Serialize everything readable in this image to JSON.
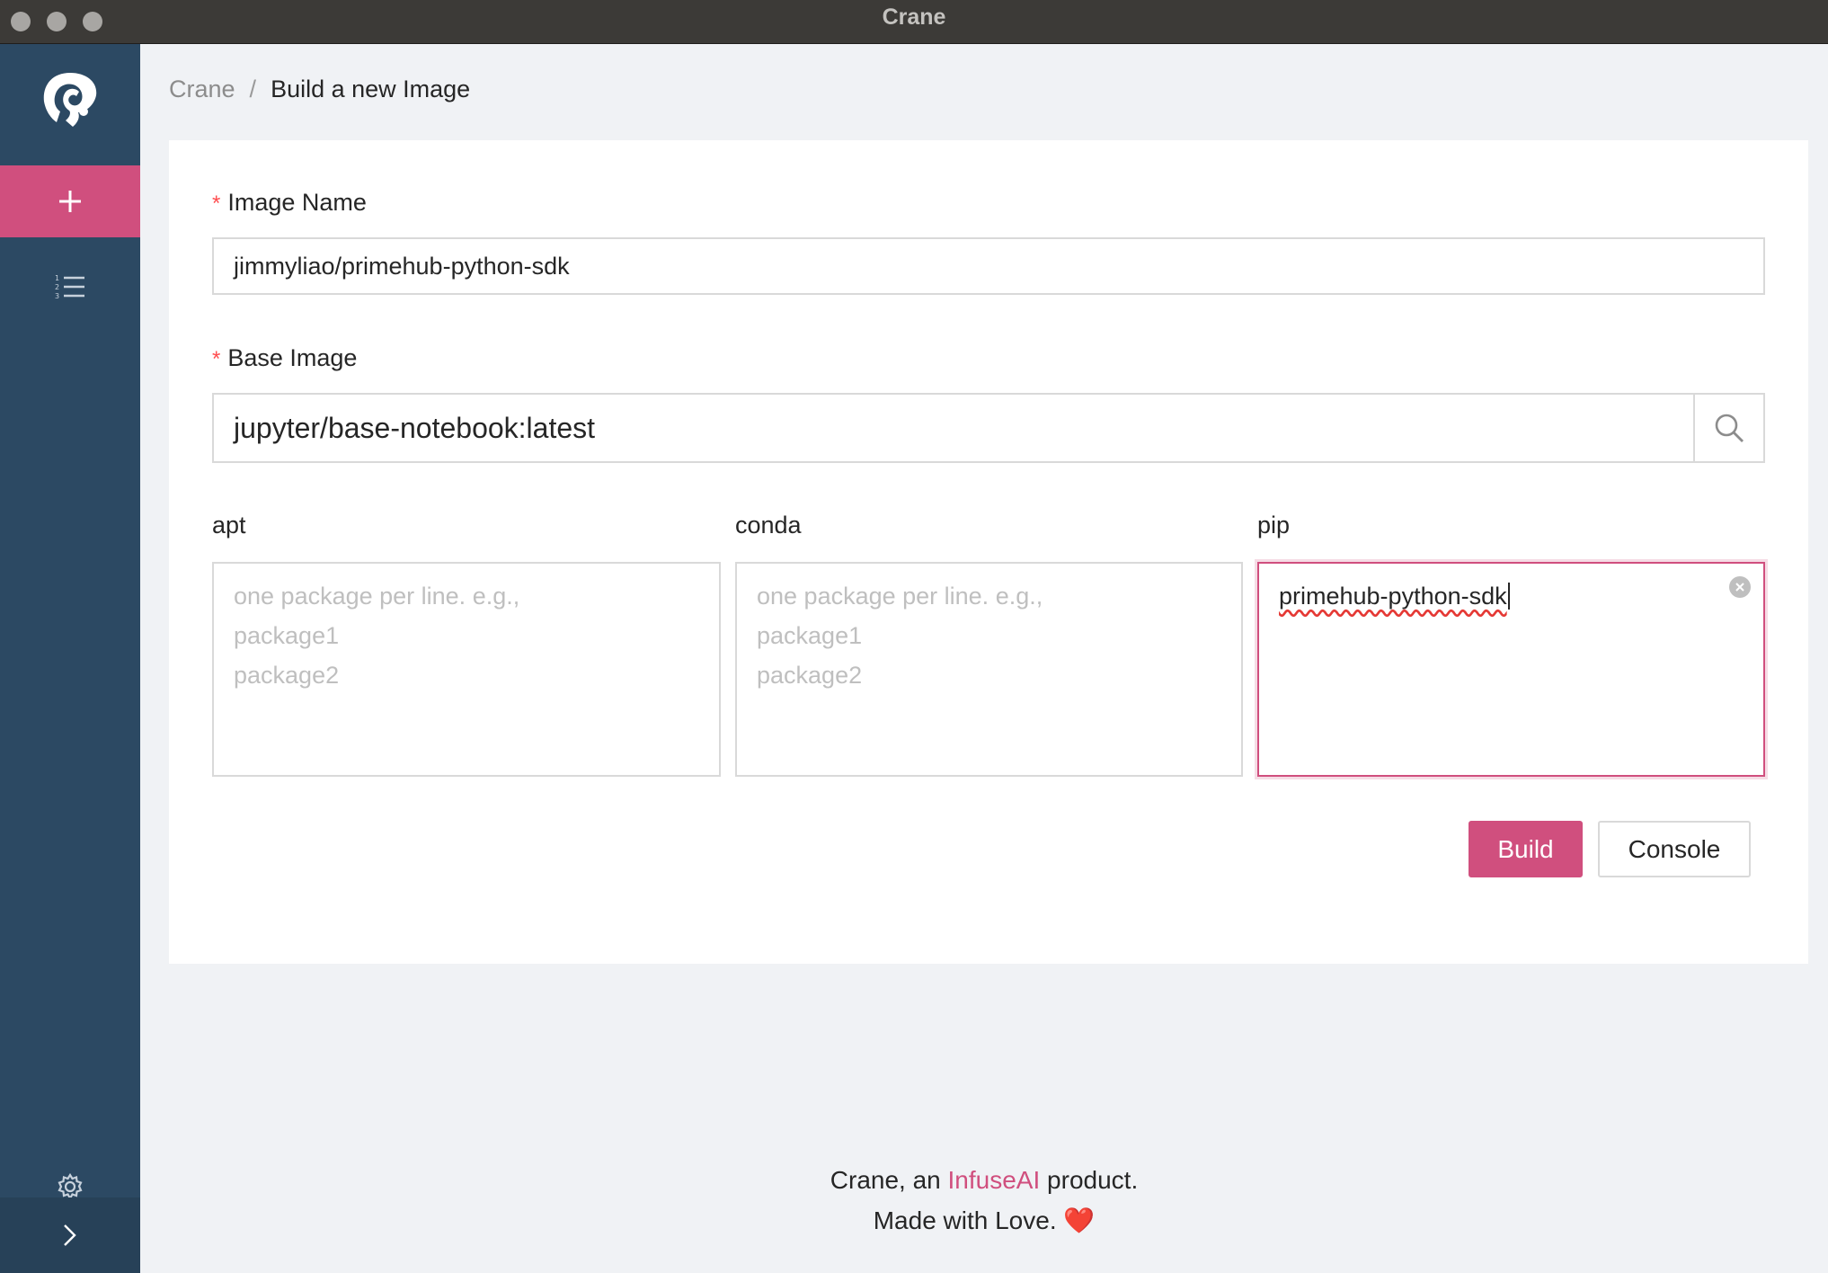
{
  "window": {
    "title": "Crane"
  },
  "sidebar": {
    "items": [
      {
        "name": "new-image",
        "icon": "plus-icon",
        "active": true
      },
      {
        "name": "image-list",
        "icon": "ordered-list-icon",
        "active": false
      }
    ],
    "settings_icon": "gear-icon",
    "collapse_icon": "chevron-right-icon"
  },
  "breadcrumb": {
    "root": "Crane",
    "separator": "/",
    "current": "Build a new Image"
  },
  "form": {
    "image_name": {
      "required_mark": "*",
      "label": "Image Name",
      "value": "jimmyliao/primehub-python-sdk"
    },
    "base_image": {
      "required_mark": "*",
      "label": "Base Image",
      "value": "jupyter/base-notebook:latest"
    },
    "apt": {
      "label": "apt",
      "value": "",
      "placeholder": "one package per line. e.g.,\npackage1\npackage2"
    },
    "conda": {
      "label": "conda",
      "value": "",
      "placeholder": "one package per line. e.g.,\npackage1\npackage2"
    },
    "pip": {
      "label": "pip",
      "value": "primehub-python-sdk"
    },
    "build_button": "Build",
    "console_button": "Console"
  },
  "footer": {
    "line1_prefix": "Crane, an ",
    "brand": "InfuseAI",
    "line1_suffix": " product.",
    "line2": "Made with Love. ",
    "heart": "❤️"
  },
  "colors": {
    "accent": "#d04f7e",
    "sidebar_bg": "#2c4963",
    "page_bg": "#f0f2f5",
    "required": "#ff4d4f"
  }
}
